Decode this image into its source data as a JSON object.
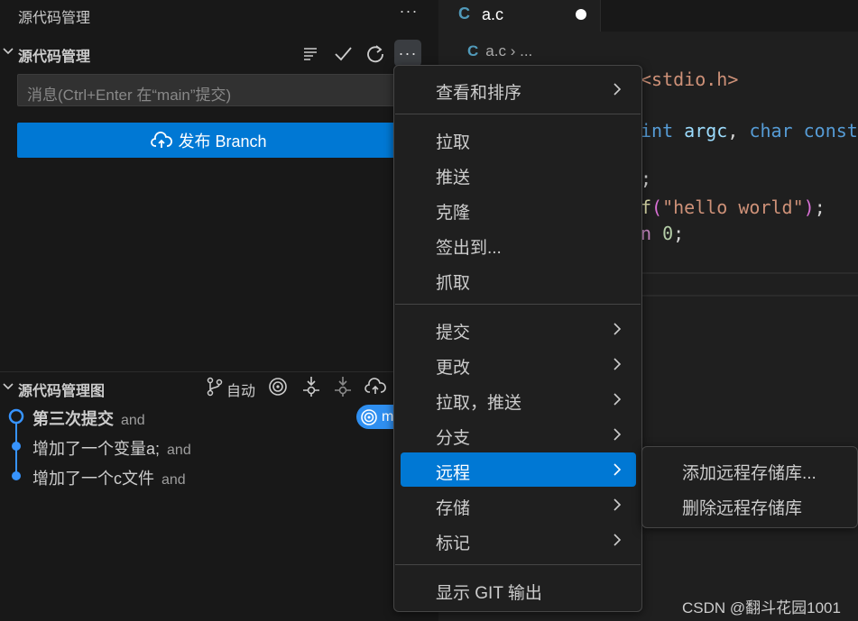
{
  "sidebar": {
    "panel_title": "源代码管理",
    "panel_more": "···",
    "scm_section": {
      "label": "源代码管理",
      "more": "···"
    },
    "message_input": {
      "placeholder": "消息(Ctrl+Enter 在“main”提交)"
    },
    "publish_button": {
      "label": "发布 Branch"
    },
    "graph_section": {
      "label": "源代码管理图",
      "auto_label": "自动",
      "branch_badge": "m",
      "commits": [
        {
          "message": "第三次提交",
          "author": "and",
          "bold": true
        },
        {
          "message": "增加了一个变量a;",
          "author": "and",
          "bold": false
        },
        {
          "message": "增加了一个c文件",
          "author": "and",
          "bold": false
        }
      ]
    }
  },
  "editor": {
    "tab": {
      "icon": "C",
      "name": "a.c"
    },
    "breadcrumb": {
      "icon": "C",
      "file": "a.c",
      "rest": "..."
    },
    "code": {
      "line1": "<stdio.h>",
      "line2_kw": "int",
      "line2_rest": " argc, ",
      "line2_kw2": "char const",
      "line3": ";",
      "line4_fn": "f",
      "line4_str": "\"hello world\"",
      "line5_kw": "n",
      "line5_num": "0"
    }
  },
  "menu": {
    "items": [
      {
        "label": "查看和排序",
        "submenu": true
      },
      {
        "label": "拉取",
        "submenu": false
      },
      {
        "label": "推送",
        "submenu": false
      },
      {
        "label": "克隆",
        "submenu": false
      },
      {
        "label": "签出到...",
        "submenu": false
      },
      {
        "label": "抓取",
        "submenu": false
      },
      {
        "label": "提交",
        "submenu": true
      },
      {
        "label": "更改",
        "submenu": true
      },
      {
        "label": "拉取，推送",
        "submenu": true
      },
      {
        "label": "分支",
        "submenu": true
      },
      {
        "label": "远程",
        "submenu": true,
        "active": true
      },
      {
        "label": "存储",
        "submenu": true
      },
      {
        "label": "标记",
        "submenu": true
      },
      {
        "label": "显示 GIT 输出",
        "submenu": false
      }
    ]
  },
  "submenu": {
    "items": [
      {
        "label": "添加远程存储库..."
      },
      {
        "label": "删除远程存储库"
      }
    ]
  },
  "watermark": "CSDN @翻斗花园1001",
  "colors": {
    "accent": "#0078d4",
    "badge": "#2f8ff0",
    "graph_dot": "#3794ff",
    "keyword": "#569cd6",
    "string": "#ce9178",
    "function": "#dcdcaa",
    "number": "#b5cea8"
  }
}
